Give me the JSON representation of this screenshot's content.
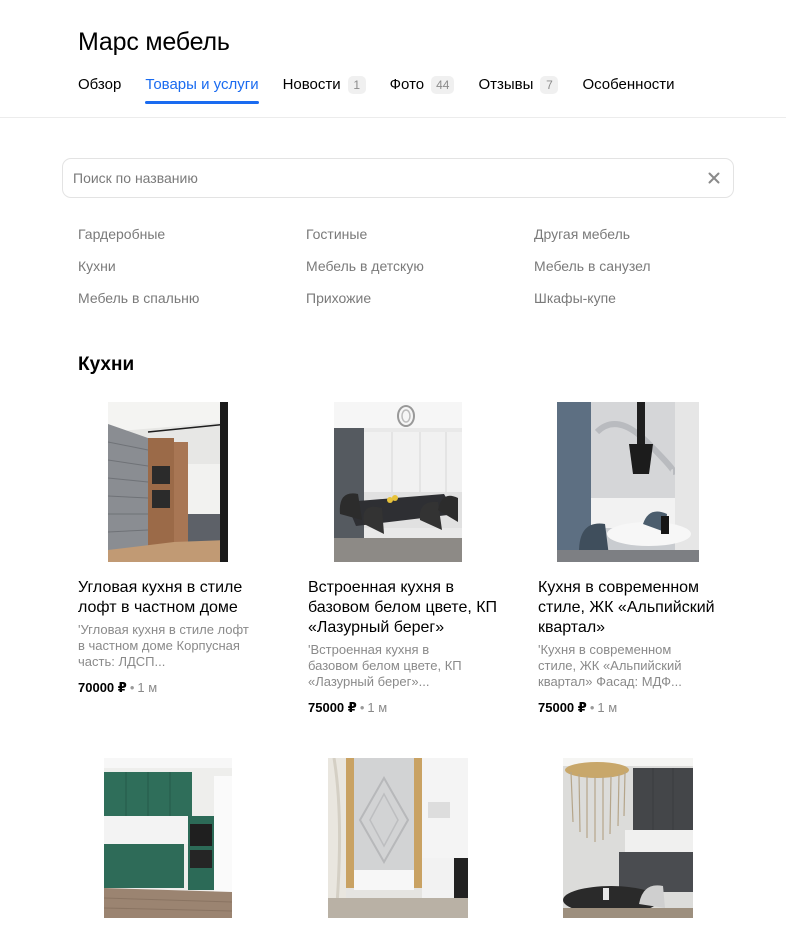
{
  "company": {
    "name": "Марс мебель"
  },
  "tabs": [
    {
      "label": "Обзор",
      "count": ""
    },
    {
      "label": "Товары и услуги",
      "count": ""
    },
    {
      "label": "Новости",
      "count": "1"
    },
    {
      "label": "Фото",
      "count": "44"
    },
    {
      "label": "Отзывы",
      "count": "7"
    },
    {
      "label": "Особенности",
      "count": ""
    }
  ],
  "active_tab": "Товары и услуги",
  "accent_color": "#1a6bf0",
  "search": {
    "placeholder": "Поиск по названию",
    "value": "",
    "clear_icon": "close-icon"
  },
  "categories": [
    "Гардеробные",
    "Гостиные",
    "Другая мебель",
    "Кухни",
    "Мебель в детскую",
    "Мебель в санузел",
    "Мебель в спальню",
    "Прихожие",
    "Шкафы-купе"
  ],
  "section": {
    "title": "Кухни"
  },
  "products": [
    {
      "title": "Угловая кухня в стиле лофт в частном доме",
      "description": "'Угловая кухня в стиле лофт в частном доме Корпусная часть: ЛДСП...",
      "price": "70000 ₽",
      "age": "1 м"
    },
    {
      "title": "Встроенная кухня в базовом белом цвете, КП «Лазурный берег»",
      "description": "'Встроенная кухня в базовом белом цвете, КП «Лазурный берег»...",
      "price": "75000 ₽",
      "age": "1 м"
    },
    {
      "title": "Кухня в современном стиле, ЖК «Альпийский квартал»",
      "description": "'Кухня в современном стиле, ЖК «Альпийский квартал» Фасад: МДФ...",
      "price": "75000 ₽",
      "age": "1 м"
    }
  ]
}
